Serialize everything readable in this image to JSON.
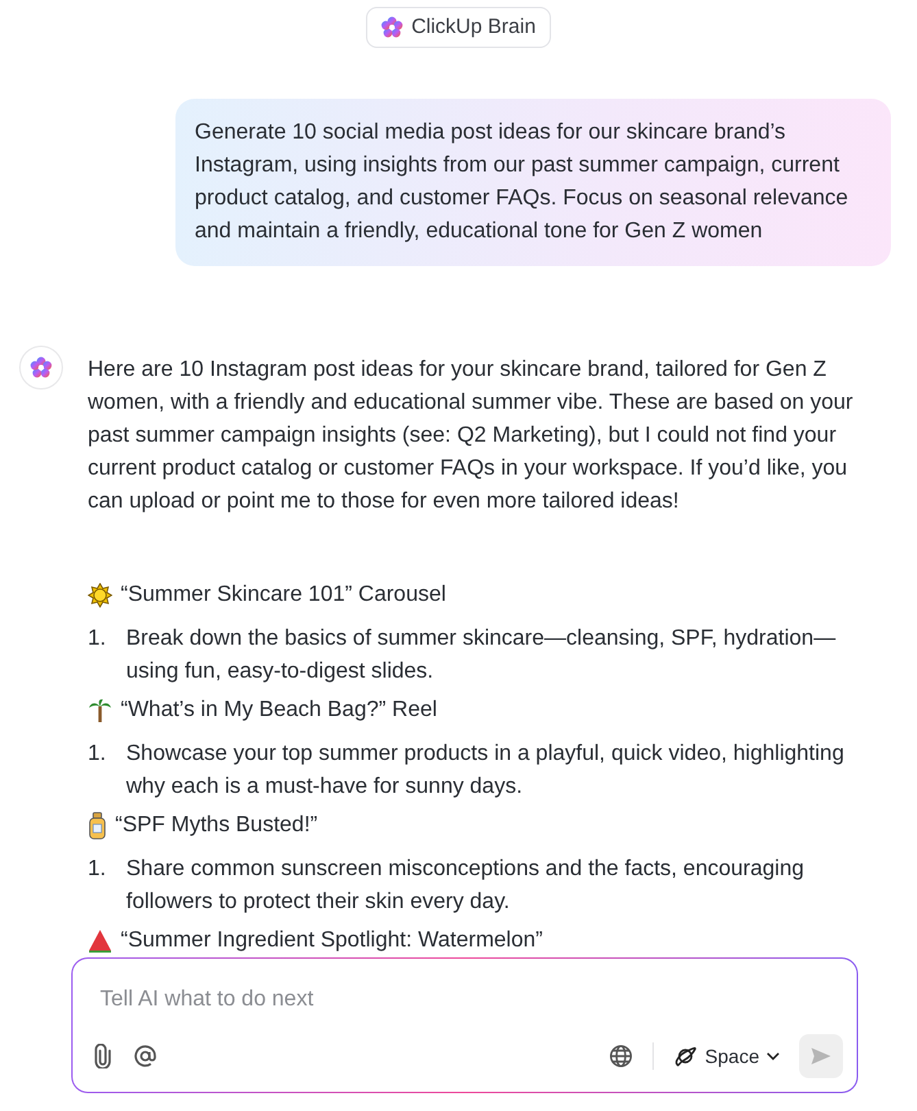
{
  "header": {
    "title": "ClickUp Brain"
  },
  "user_message": "Generate 10 social media post ideas for our skincare brand’s Instagram, using insights from our past summer campaign, current product catalog, and customer FAQs. Focus on seasonal relevance and maintain a friendly, educational tone for Gen Z women",
  "ai_message": {
    "intro": "Here are 10 Instagram post ideas for your skincare brand, tailored for Gen Z women, with a friendly and educational summer vibe. These are based on your past summer campaign insights (see: Q2 Marketing), but I could not find your current product catalog or customer FAQs in your workspace. If you’d like, you can upload or point me to those for even more tailored ideas!",
    "ideas": [
      {
        "kind": "sun",
        "title": "“Summer Skincare 101” Carousel",
        "points": [
          {
            "number": "1.",
            "text": "Break down the basics of summer skincare—cleansing, SPF, hydration—using fun, easy-to-digest slides."
          }
        ]
      },
      {
        "kind": "palm",
        "title": "“What’s in My Beach Bag?” Reel",
        "points": [
          {
            "number": "1.",
            "text": "Showcase your top summer products in a playful, quick video, highlighting why each is a must-have for sunny days."
          }
        ]
      },
      {
        "kind": "bottle",
        "title": "“SPF Myths Busted!”",
        "points": [
          {
            "number": "1.",
            "text": "Share common sunscreen misconceptions and the facts, encouraging followers to protect their skin every day."
          }
        ]
      },
      {
        "kind": "watermelon",
        "title": "“Summer Ingredient Spotlight: Watermelon”"
      }
    ]
  },
  "composer": {
    "placeholder": "Tell AI what to do next",
    "space_label": "Space"
  }
}
